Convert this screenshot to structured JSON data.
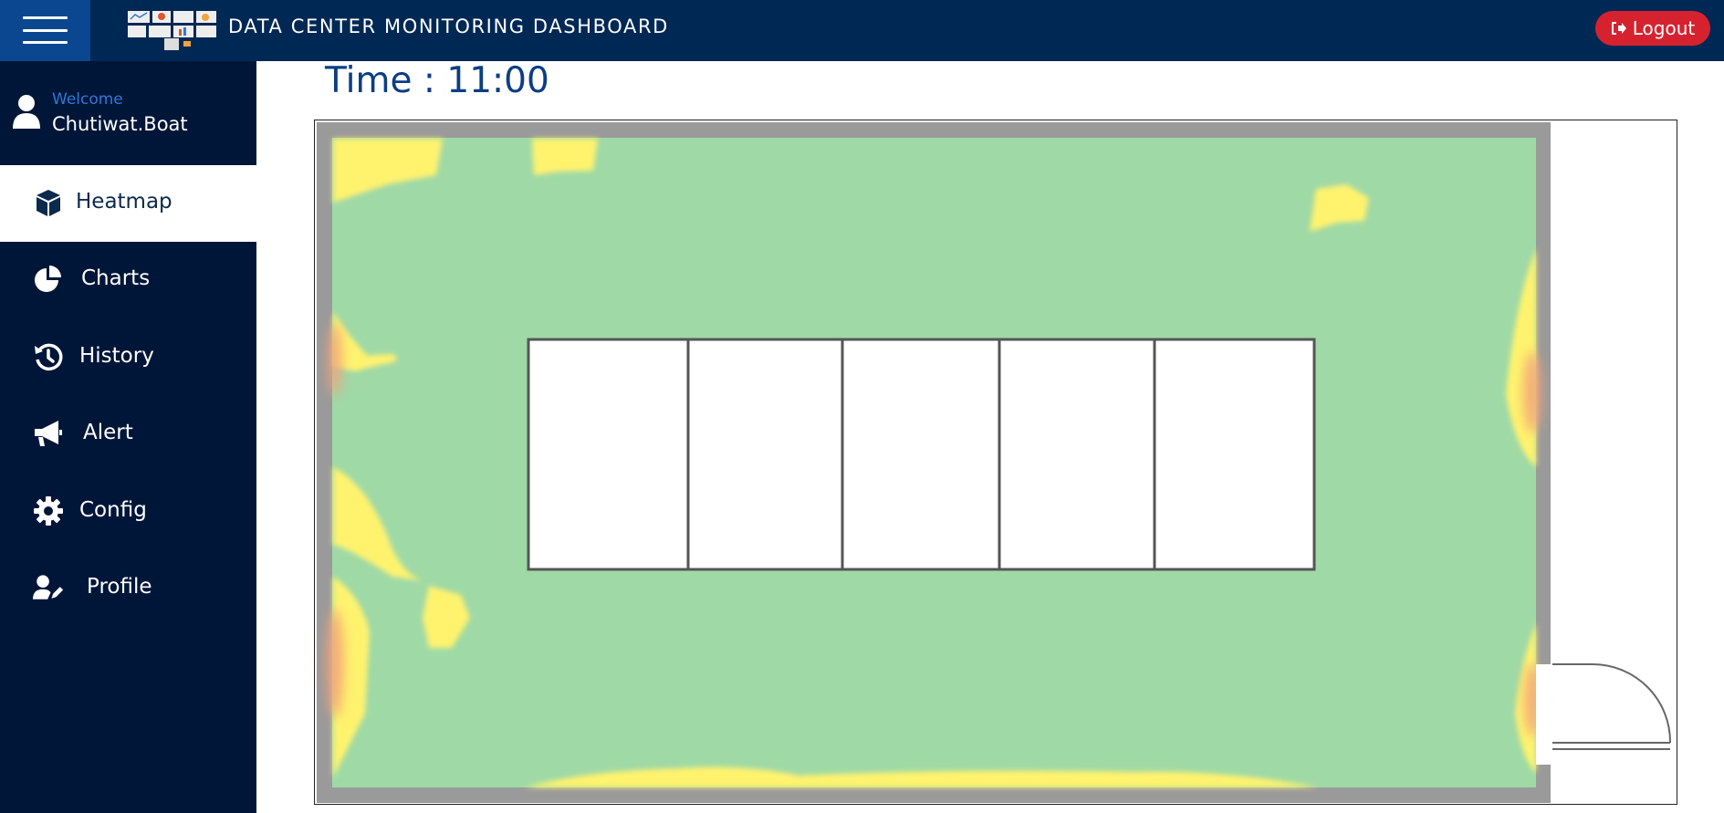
{
  "header": {
    "title": "DATA CENTER MONITORING DASHBOARD",
    "logout_label": "Logout",
    "colors": {
      "bar": "#002855",
      "menu_button": "#0a4790",
      "logout": "#d6222f"
    }
  },
  "user": {
    "welcome": "Welcome",
    "name": "Chutiwat.Boat"
  },
  "sidebar": {
    "items": [
      {
        "label": "Heatmap",
        "icon": "cube-icon",
        "active": true
      },
      {
        "label": "Charts",
        "icon": "pie-chart-icon",
        "active": false
      },
      {
        "label": "History",
        "icon": "history-icon",
        "active": false
      },
      {
        "label": "Alert",
        "icon": "megaphone-icon",
        "active": false
      },
      {
        "label": "Config",
        "icon": "gear-icon",
        "active": false
      },
      {
        "label": "Profile",
        "icon": "user-edit-icon",
        "active": false
      }
    ]
  },
  "main": {
    "time_label": "Time : 11:00",
    "heatmap": {
      "rack_count": 5,
      "colors": {
        "normal": "#9fd9a6",
        "warm": "#fff36e",
        "hot": "#f3a27a",
        "wall": "#9a9a9a"
      }
    }
  }
}
